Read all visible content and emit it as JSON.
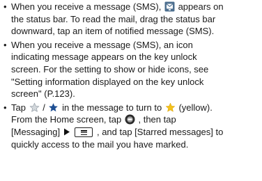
{
  "notes": [
    {
      "parts": [
        "When you receive a message (SMS),",
        "appears on",
        "the status bar. To read the mail, drag the status bar",
        "downward, tap an item of notified message (SMS)."
      ]
    },
    {
      "parts": [
        "When you receive a message (SMS), an icon",
        "indicating message appears on the key unlock",
        "screen. For the setting to show or hide icons, see",
        "\"Setting information displayed on the key unlock",
        "screen\" (P.123)."
      ]
    },
    {
      "parts": [
        "Tap",
        "/",
        "in the message to turn to",
        "(yellow).",
        "From the Home screen, tap",
        ", then tap",
        "[Messaging]",
        ", and tap [Starred messages] to",
        "quickly access to the mail you have marked."
      ]
    }
  ],
  "icons": {
    "sms_status": "sms-notification-icon",
    "star_off": "star-outline-icon",
    "star_on": "star-filled-icon",
    "star_yellow": "star-yellow-icon",
    "apps": "apps-icon",
    "arrow": "right-triangle-icon",
    "menu": "menu-key-icon"
  },
  "colors": {
    "text": "#1a1a1a",
    "star_gray": "#b9c0c6",
    "star_blue": "#1e4f93",
    "star_yellow": "#f4c21b",
    "sms_icon_bg": "#4d6f8f"
  }
}
